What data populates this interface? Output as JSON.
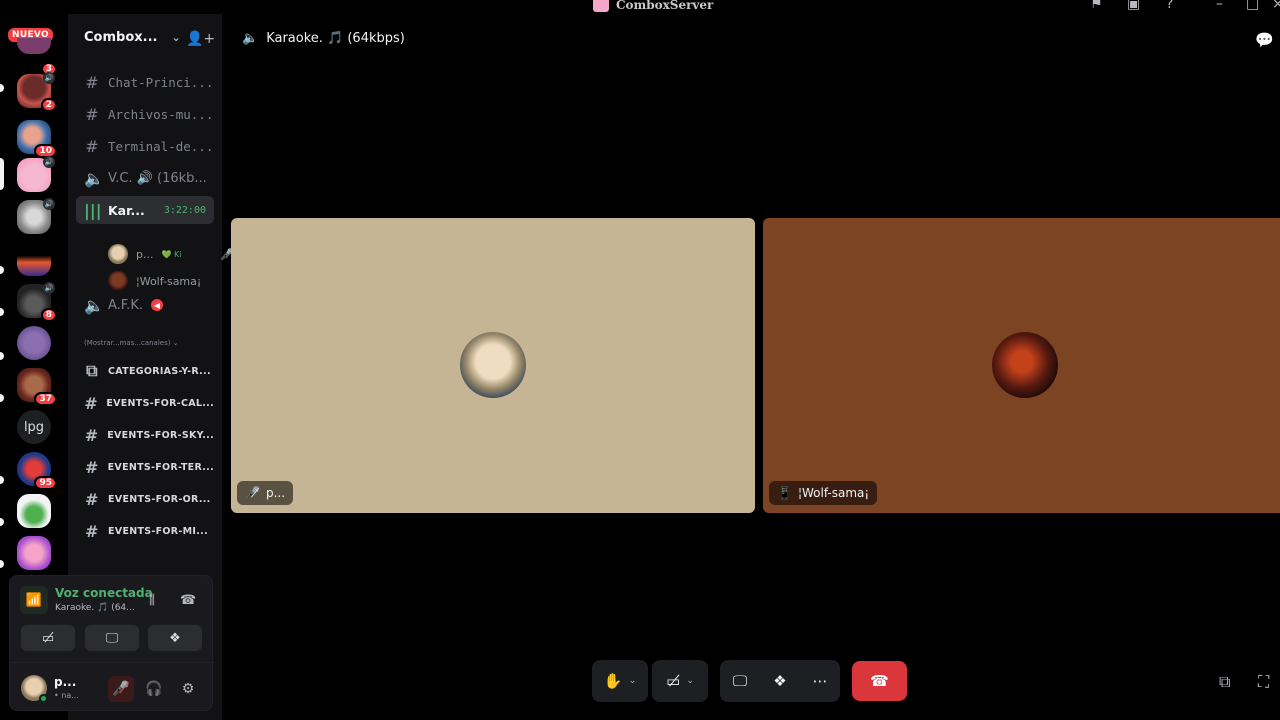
{
  "window": {
    "title": "ComboxServer"
  },
  "rail": {
    "nuevo_label": "NUEVO",
    "badges": [
      "3",
      "2",
      "10",
      "8",
      "37",
      "95"
    ],
    "text_server": "lpg"
  },
  "sidebar": {
    "server_name": "Combox...",
    "channels": [
      {
        "label": "Chat-Princi..."
      },
      {
        "label": "Archivos-mu..."
      },
      {
        "label": "Terminal-de..."
      },
      {
        "label": "V.C. 🔊 (16kb..."
      },
      {
        "label": "Kar...",
        "timer": "3:22:00"
      },
      {
        "label": "A.F.K."
      }
    ],
    "voice_users": [
      {
        "name": "p...",
        "activity": "💚 Ki"
      },
      {
        "name": "¦Wolf-sama¡"
      }
    ],
    "more_channels": "(Mostrar...mas...canales)",
    "categories": [
      "CATEGORIAS-Y-R...",
      "EVENTS-FOR-CAL...",
      "EVENTS-FOR-SKY...",
      "EVENTS-FOR-TER...",
      "EVENTS-FOR-OR...",
      "EVENTS-FOR-MI..."
    ]
  },
  "voice_panel": {
    "status": "Voz conectada",
    "channel": "Karaoke. 🎵 (64..."
  },
  "user": {
    "name": "p...",
    "status": "• na..."
  },
  "main": {
    "channel_title": "Karaoke. 🎵 (64kbps)",
    "tiles": [
      {
        "name": "p...",
        "bg": "#c6b595"
      },
      {
        "name": "¦Wolf-sama¡",
        "bg": "#7d4424"
      }
    ]
  },
  "colors": {
    "accent_green": "#4fb070",
    "danger": "#da373c",
    "badge_red": "#f23f43"
  }
}
